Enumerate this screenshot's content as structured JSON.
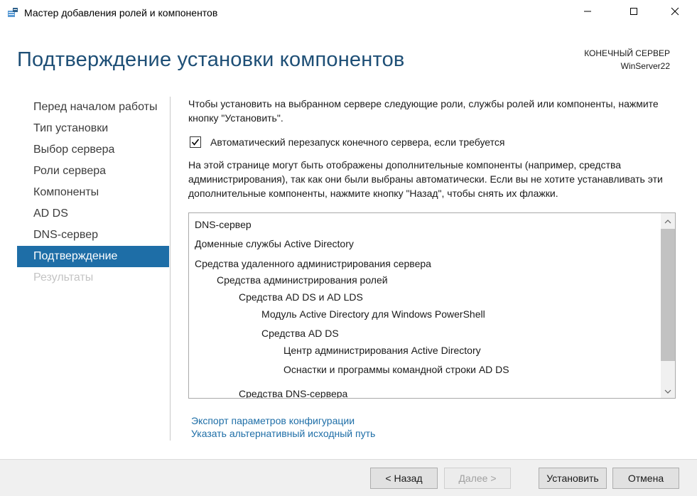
{
  "window": {
    "title": "Мастер добавления ролей и компонентов",
    "icons": {
      "app": "server-manager-icon",
      "minimize": "minimize-icon",
      "maximize": "maximize-icon",
      "close": "close-icon"
    }
  },
  "header": {
    "title": "Подтверждение установки компонентов",
    "destination_label": "КОНЕЧНЫЙ СЕРВЕР",
    "destination_name": "WinServer22"
  },
  "nav": {
    "items": [
      {
        "label": "Перед началом работы",
        "state": "normal"
      },
      {
        "label": "Тип установки",
        "state": "normal"
      },
      {
        "label": "Выбор сервера",
        "state": "normal"
      },
      {
        "label": "Роли сервера",
        "state": "normal"
      },
      {
        "label": "Компоненты",
        "state": "normal"
      },
      {
        "label": "AD DS",
        "state": "normal"
      },
      {
        "label": "DNS-сервер",
        "state": "normal"
      },
      {
        "label": "Подтверждение",
        "state": "active"
      },
      {
        "label": "Результаты",
        "state": "disabled"
      }
    ]
  },
  "main": {
    "intro": "Чтобы установить на выбранном сервере следующие роли, службы ролей или компоненты, нажмите кнопку \"Установить\".",
    "restart_checkbox": {
      "label": "Автоматический перезапуск конечного сервера, если требуется",
      "checked": true
    },
    "note": "На этой странице могут быть отображены дополнительные компоненты (например, средства администрирования), так как они были выбраны автоматически. Если вы не хотите устанавливать эти дополнительные компоненты, нажмите кнопку \"Назад\", чтобы снять их флажки.",
    "components": [
      {
        "label": "DNS-сервер",
        "level": 0
      },
      {
        "label": "Доменные службы Active Directory",
        "level": 0
      },
      {
        "label": "Средства удаленного администрирования сервера",
        "level": 0
      },
      {
        "label": "Средства администрирования ролей",
        "level": 1
      },
      {
        "label": "Средства AD DS и AD LDS",
        "level": 2
      },
      {
        "label": "Модуль Active Directory для Windows PowerShell",
        "level": 3
      },
      {
        "label": "Средства AD DS",
        "level": 3
      },
      {
        "label": "Центр администрирования Active Directory",
        "level": 4
      },
      {
        "label": "Оснастки и программы командной строки AD DS",
        "level": 4
      },
      {
        "label": "Средства DNS-сервера",
        "level": 2
      }
    ],
    "links": {
      "export": "Экспорт параметров конфигурации",
      "alt_source": "Указать альтернативный исходный путь"
    }
  },
  "footer": {
    "back_label": "< Назад",
    "next_label": "Далее >",
    "install_label": "Установить",
    "cancel_label": "Отмена",
    "next_enabled": false
  },
  "colors": {
    "accent": "#1e6ea7",
    "title": "#1e4f76",
    "disabled_text": "#c4c4c4"
  }
}
